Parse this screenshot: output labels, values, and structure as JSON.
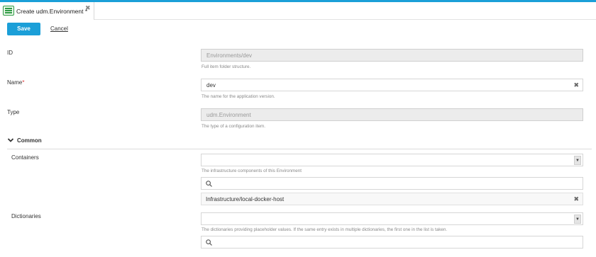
{
  "tab": {
    "title": "Create udm.Environment *",
    "close_glyph": "✖"
  },
  "toolbar": {
    "save_label": "Save",
    "cancel_label": "Cancel"
  },
  "form": {
    "id": {
      "label": "ID",
      "value": "Environments/dev",
      "help": "Full item folder structure."
    },
    "name": {
      "label": "Name",
      "required_mark": "*",
      "value": "dev",
      "help": "The name for the application version."
    },
    "type": {
      "label": "Type",
      "value": "udm.Environment",
      "help": "The type of a configuration item."
    }
  },
  "common": {
    "title": "Common",
    "containers": {
      "label": "Containers",
      "help": "The infrastructure components of this Environment",
      "selected": [
        "Infrastructure/local-docker-host"
      ]
    },
    "dictionaries": {
      "label": "Dictionaries",
      "help": "The dictionaries providing placeholder values. If the same entry exists in multiple dictionaries, the first one in the list is taken."
    }
  },
  "icons": {
    "tab_icon": "environment-icon",
    "clear": "clear-icon",
    "dropdown": "dropdown-arrow-icon",
    "search": "search-icon",
    "chevron": "chevron-down-icon",
    "accent": "#1b9fd8"
  }
}
